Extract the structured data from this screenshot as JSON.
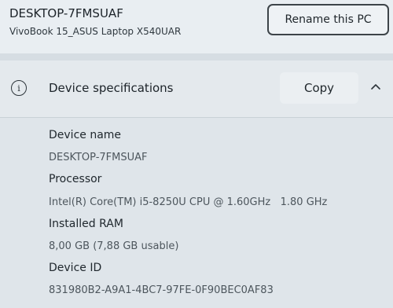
{
  "device": {
    "pc_name": "DESKTOP-7FMSUAF",
    "model": "VivoBook 15_ASUS Laptop X540UAR",
    "rename_label": "Rename this PC"
  },
  "specifications": {
    "title": "Device specifications",
    "info_icon": "info-icon",
    "copy_label": "Copy",
    "collapse_icon": "chevron-up-icon",
    "items": [
      {
        "label": "Device name",
        "value": "DESKTOP-7FMSUAF"
      },
      {
        "label": "Processor",
        "value": "Intel(R) Core(TM) i5-8250U CPU @ 1.60GHz   1.80 GHz"
      },
      {
        "label": "Installed RAM",
        "value": "8,00 GB (7,88 GB usable)"
      },
      {
        "label": "Device ID",
        "value": "831980B2-A9A1-4BC7-97FE-0F90BEC0AF83"
      }
    ]
  }
}
